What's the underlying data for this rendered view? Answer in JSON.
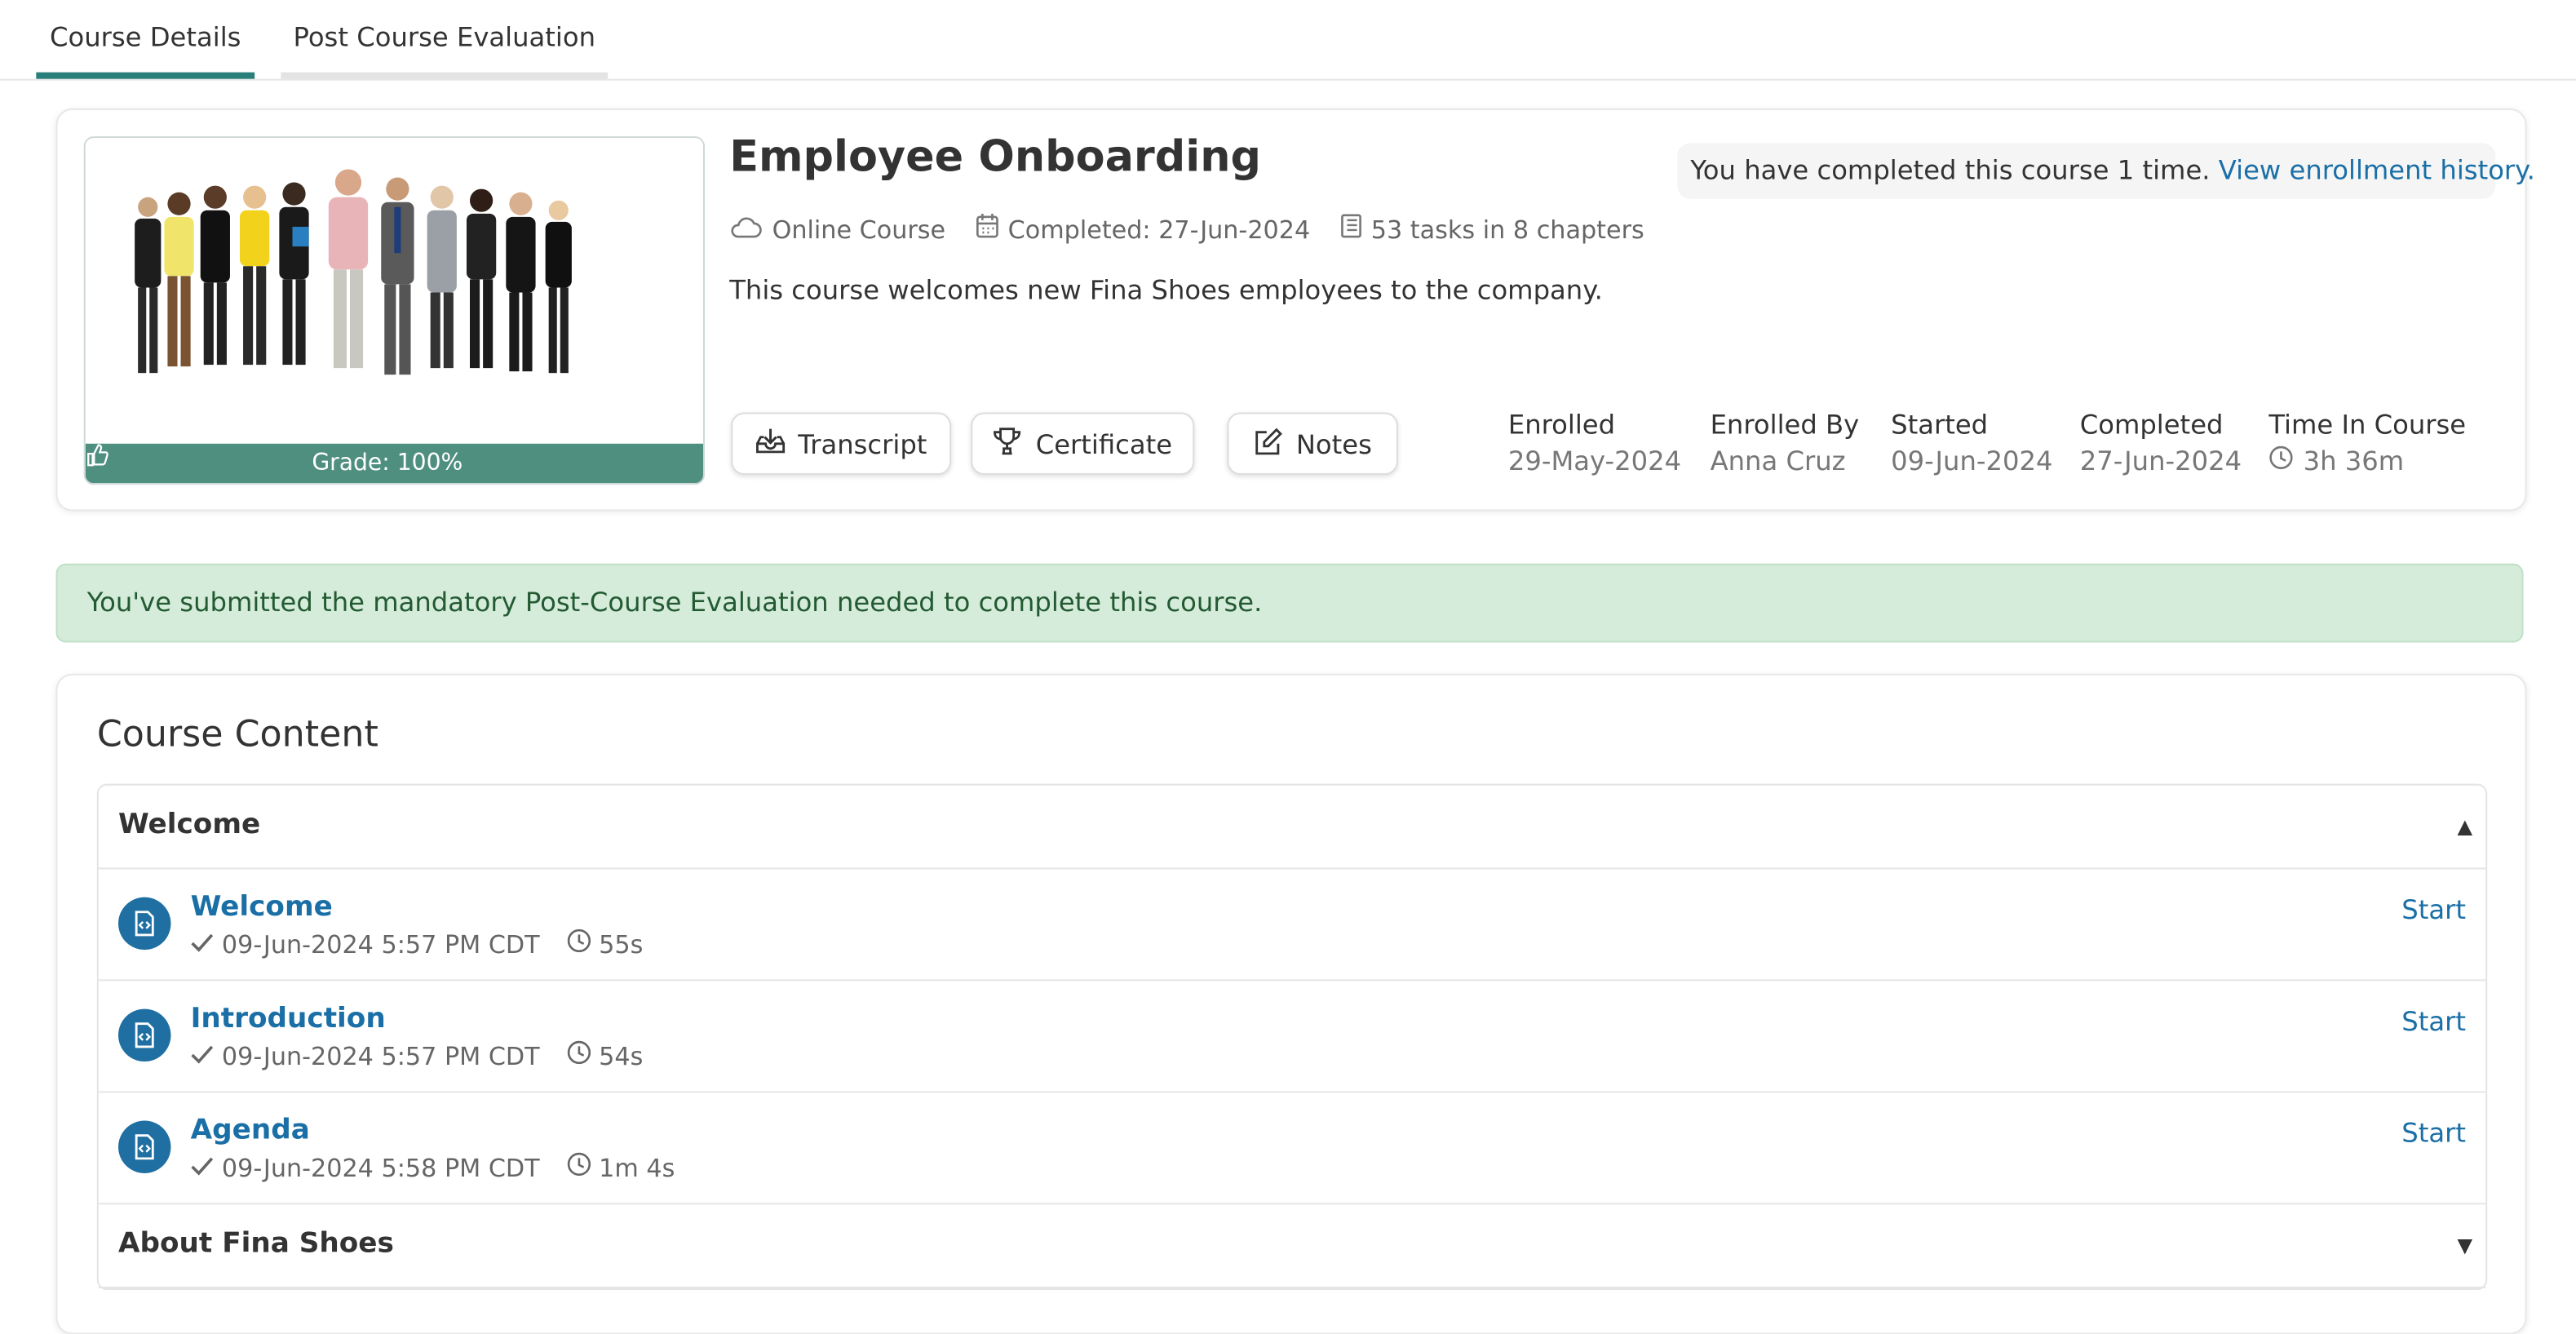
{
  "tabs": [
    {
      "label": "Course Details"
    },
    {
      "label": "Post Course Evaluation"
    }
  ],
  "course": {
    "title": "Employee Onboarding",
    "type": "Online Course",
    "completed_date": "Completed: 27-Jun-2024",
    "tasks_summary": "53 tasks in 8 chapters",
    "description": "This course welcomes new Fina Shoes employees to the company.",
    "grade": "Grade: 100%",
    "completed_note": "You have completed this course 1 time.",
    "history_link": "View enrollment history."
  },
  "buttons": {
    "transcript": "Transcript",
    "certificate": "Certificate",
    "notes": "Notes"
  },
  "stats": {
    "enrolled_label": "Enrolled",
    "enrolled_value": "29-May-2024",
    "enrolled_by_label": "Enrolled By",
    "enrolled_by_value": "Anna Cruz",
    "started_label": "Started",
    "started_value": "09-Jun-2024",
    "completed_label": "Completed",
    "completed_value": "27-Jun-2024",
    "time_label": "Time In Course",
    "time_value": "3h 36m"
  },
  "alert": "You've submitted the mandatory Post-Course Evaluation needed to complete this course.",
  "content": {
    "title": "Course Content",
    "chapters": [
      {
        "name": "Welcome",
        "expanded": true,
        "tasks": [
          {
            "name": "Welcome",
            "date": "09-Jun-2024 5:57 PM CDT",
            "duration": "55s",
            "action": "Start"
          },
          {
            "name": "Introduction",
            "date": "09-Jun-2024 5:57 PM CDT",
            "duration": "54s",
            "action": "Start"
          },
          {
            "name": "Agenda",
            "date": "09-Jun-2024 5:58 PM CDT",
            "duration": "1m 4s",
            "action": "Start"
          }
        ]
      },
      {
        "name": "About Fina Shoes",
        "expanded": false
      }
    ]
  },
  "colors": {
    "accent": "#2a7f7a",
    "link": "#1a6fa6",
    "success_bg": "#d4ecd9",
    "grade_bar": "#4f8f7f",
    "task_icon_bg": "#1f6fa3"
  },
  "icons": {
    "type": "cloud-icon",
    "date": "calendar-icon",
    "tasks": "book-icon",
    "transcript": "download-tray-icon",
    "certificate": "trophy-icon",
    "notes": "edit-icon",
    "time": "clock-icon",
    "task": "document-icon",
    "done": "check-icon",
    "grade": "thumbs-up-icon"
  }
}
